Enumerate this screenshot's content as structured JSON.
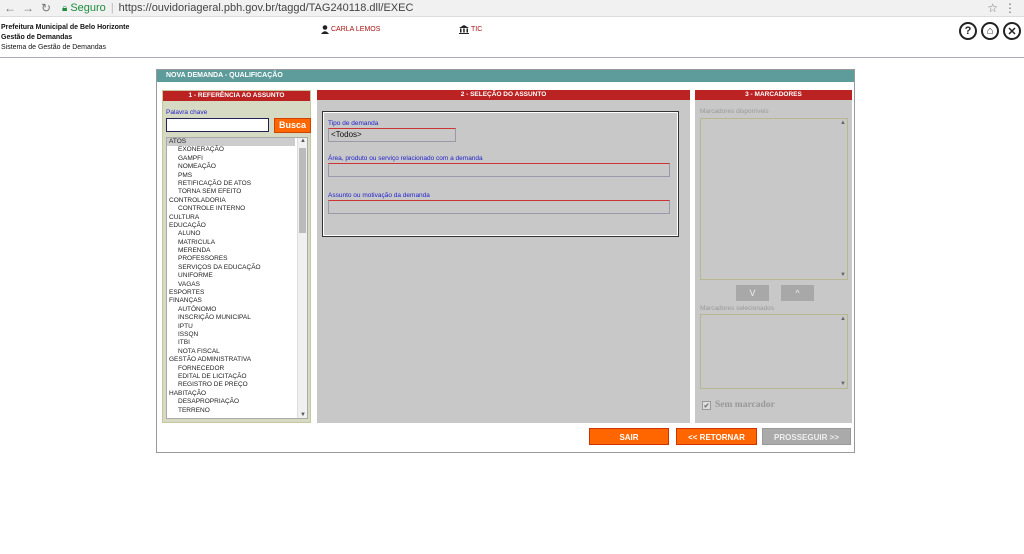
{
  "browser": {
    "secure_label": "Seguro",
    "url": "https://ouvidoriageral.pbh.gov.br/taggd/TAG240118.dll/EXEC"
  },
  "header": {
    "org_line1": "Prefeitura Municipal de Belo Horizonte",
    "org_line2": "Gestão de Demandas",
    "org_line3": "Sistema de Gestão de Demandas",
    "user_name": "CARLA LEMOS",
    "unit_name": "TIC",
    "help_glyph": "?",
    "home_glyph": "⌂",
    "close_glyph": "✕"
  },
  "frame": {
    "title": "NOVA DEMANDA - QUALIFICAÇÃO"
  },
  "panel1": {
    "title": "1 - REFERÊNCIA AO ASSUNTO",
    "keyword_label": "Palavra chave",
    "keyword_value": "",
    "search_button": "Busca",
    "tree": [
      {
        "label": "ATOS",
        "level": 0,
        "selected": true
      },
      {
        "label": "EXONERAÇÃO",
        "level": 1
      },
      {
        "label": "GAMPFI",
        "level": 1
      },
      {
        "label": "NOMEAÇÃO",
        "level": 1
      },
      {
        "label": "PMS",
        "level": 1
      },
      {
        "label": "RETIFICAÇÃO DE ATOS",
        "level": 1
      },
      {
        "label": "TORNA SEM EFEITO",
        "level": 1
      },
      {
        "label": "CONTROLADORIA",
        "level": 0
      },
      {
        "label": "CONTROLE INTERNO",
        "level": 1
      },
      {
        "label": "CULTURA",
        "level": 0
      },
      {
        "label": "EDUCAÇÃO",
        "level": 0
      },
      {
        "label": "ALUNO",
        "level": 1
      },
      {
        "label": "MATRICULA",
        "level": 1
      },
      {
        "label": "MERENDA",
        "level": 1
      },
      {
        "label": "PROFESSORES",
        "level": 1
      },
      {
        "label": "SERVIÇOS DA EDUCAÇÃO",
        "level": 1
      },
      {
        "label": "UNIFORME",
        "level": 1
      },
      {
        "label": "VAGAS",
        "level": 1
      },
      {
        "label": "ESPORTES",
        "level": 0
      },
      {
        "label": "FINANÇAS",
        "level": 0
      },
      {
        "label": "AUTÔNOMO",
        "level": 1
      },
      {
        "label": "INSCRIÇÃO MUNICIPAL",
        "level": 1
      },
      {
        "label": "IPTU",
        "level": 1
      },
      {
        "label": "ISSQN",
        "level": 1
      },
      {
        "label": "ITBI",
        "level": 1
      },
      {
        "label": "NOTA FISCAL",
        "level": 1
      },
      {
        "label": "GESTÃO ADMINISTRATIVA",
        "level": 0
      },
      {
        "label": "FORNECEDOR",
        "level": 1
      },
      {
        "label": "EDITAL DE LICITAÇÃO",
        "level": 1
      },
      {
        "label": "REGISTRO DE PREÇO",
        "level": 1
      },
      {
        "label": "HABITAÇÃO",
        "level": 0
      },
      {
        "label": "DESAPROPRIAÇÃO",
        "level": 1
      },
      {
        "label": "TERRENO",
        "level": 1
      }
    ]
  },
  "panel2": {
    "title": "2 - SELEÇÃO DO ASSUNTO",
    "tipo_label": "Tipo de demanda",
    "tipo_value": "<Todos>",
    "area_label": "Área, produto ou serviço relacionado com a demanda",
    "area_value": "",
    "assunto_label": "Assunto ou motivação da demanda",
    "assunto_value": ""
  },
  "panel3": {
    "title": "3 - MARCADORES",
    "available_label": "Marcadores disponíveis",
    "selected_label": "Marcadores selecionados",
    "down_button": "V",
    "up_button": "^",
    "no_marker_label": "Sem marcador",
    "no_marker_checked": true
  },
  "actions": {
    "exit": "SAIR",
    "back": "<< RETORNAR",
    "next": "PROSSEGUIR >>"
  }
}
